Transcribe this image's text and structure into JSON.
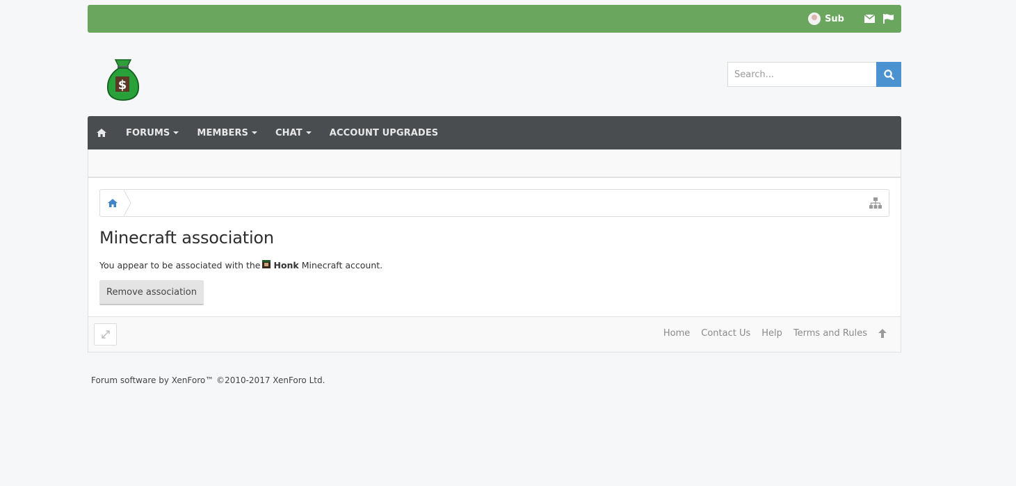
{
  "userbar": {
    "username": "Sub"
  },
  "search": {
    "placeholder": "Search..."
  },
  "nav": {
    "items": [
      {
        "label": "FORUMS"
      },
      {
        "label": "MEMBERS"
      },
      {
        "label": "CHAT"
      },
      {
        "label": "ACCOUNT UPGRADES"
      }
    ]
  },
  "page": {
    "title": "Minecraft association",
    "desc_prefix": "You appear to be associated with the",
    "account_name": "Honk",
    "desc_suffix": "Minecraft account.",
    "remove_button": "Remove association"
  },
  "footer": {
    "links": [
      "Home",
      "Contact Us",
      "Help",
      "Terms and Rules"
    ],
    "copyright": "Forum software by XenForo™ ©2010-2017 XenForo Ltd."
  },
  "colors": {
    "userbar": "#6aa65e",
    "nav": "#4a4d50",
    "search_button": "#4b93d0"
  }
}
